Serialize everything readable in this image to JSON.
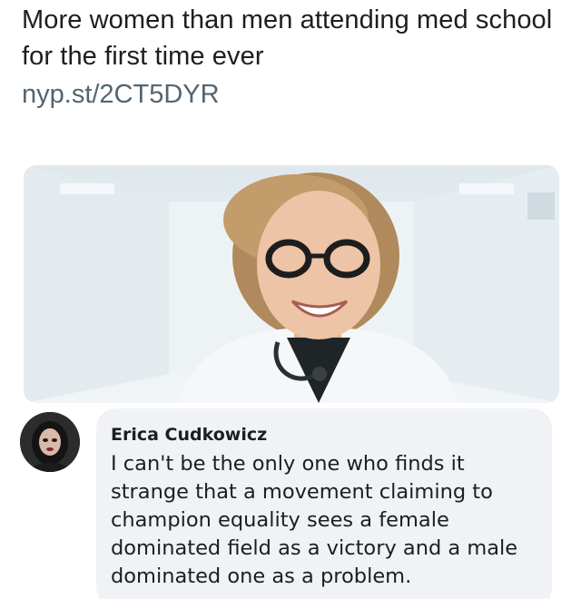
{
  "post": {
    "headline": "More women than men attending med school for the first time ever",
    "link": "nyp.st/2CT5DYR"
  },
  "photo": {
    "subject": "smiling-doctor-photo"
  },
  "comment": {
    "author": "Erica Cudkowicz",
    "text": "I can't be the only one who finds it strange that a movement claiming to champion equality sees a female dominated field as a victory and a male dominated one as a problem."
  }
}
